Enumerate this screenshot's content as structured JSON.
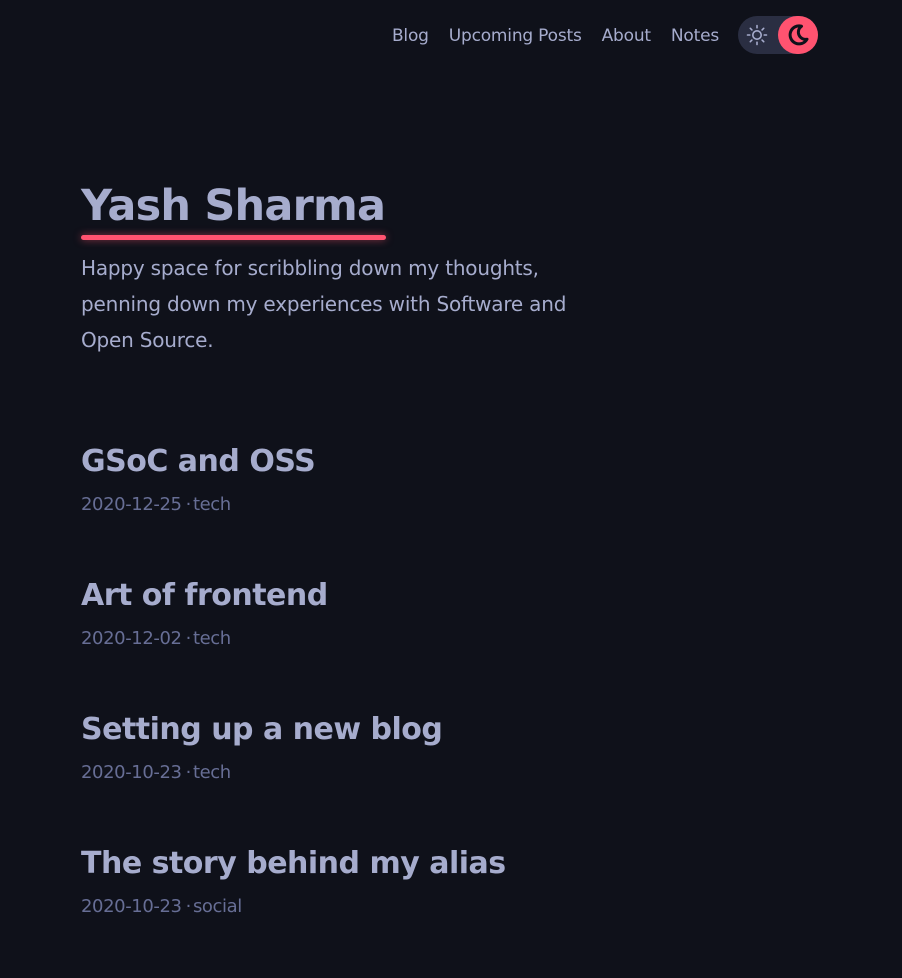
{
  "nav": {
    "links": [
      {
        "label": "Blog"
      },
      {
        "label": "Upcoming Posts"
      },
      {
        "label": "About"
      },
      {
        "label": "Notes"
      }
    ],
    "theme_toggle": {
      "state": "dark",
      "left_icon": "sun-icon",
      "right_icon": "moon-icon"
    }
  },
  "hero": {
    "title": "Yash Sharma",
    "subtitle": "Happy space for scribbling down my thoughts, penning down my experiences with Software and Open Source."
  },
  "posts": [
    {
      "title": "GSoC and OSS",
      "date": "2020-12-25",
      "separator": "·",
      "tag": "tech"
    },
    {
      "title": "Art of frontend",
      "date": "2020-12-02",
      "separator": "·",
      "tag": "tech"
    },
    {
      "title": "Setting up a new blog",
      "date": "2020-10-23",
      "separator": "·",
      "tag": "tech"
    },
    {
      "title": "The story behind my alias",
      "date": "2020-10-23",
      "separator": "·",
      "tag": "social"
    }
  ],
  "colors": {
    "background": "#0f111a",
    "text": "#a6accd",
    "muted": "#676e95",
    "accent": "#ff5370",
    "toggle_track": "#2a2e42"
  }
}
